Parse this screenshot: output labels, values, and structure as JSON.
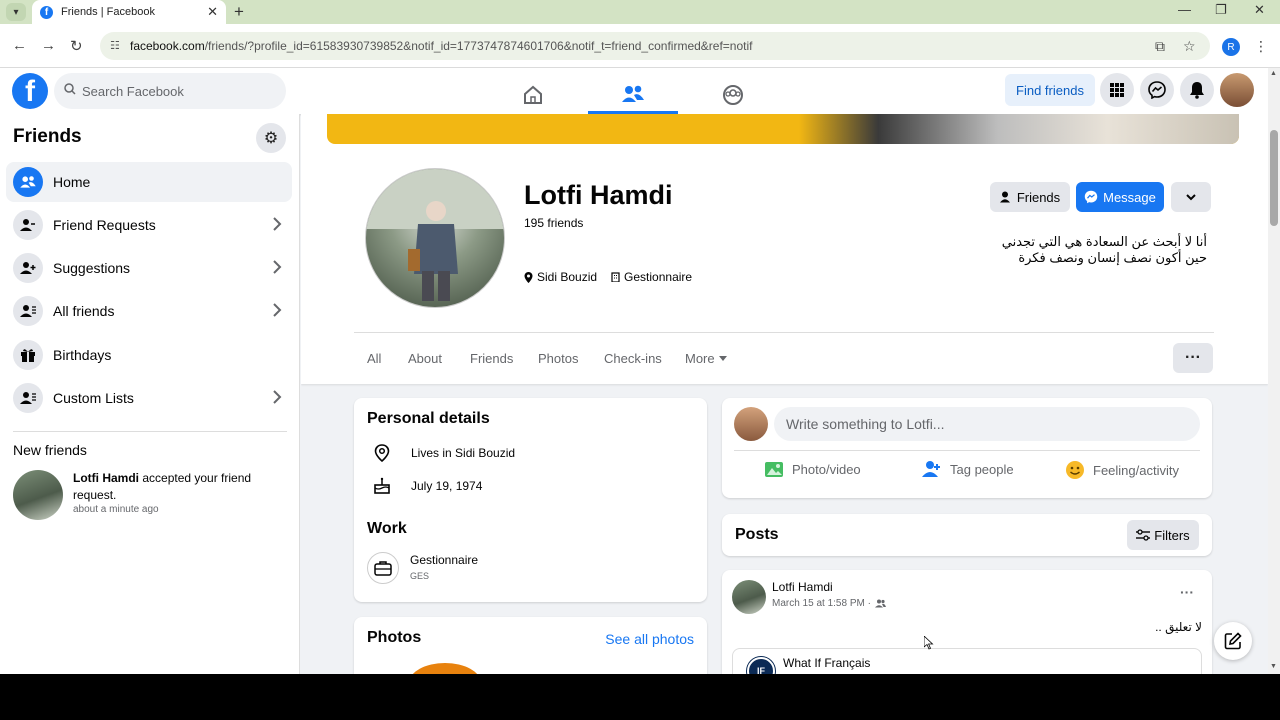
{
  "browser": {
    "tab_title": "Friends | Facebook",
    "url_domain": "facebook.com",
    "url_rest": "/friends/?profile_id=61583930739852&notif_id=1773747874601706&notif_t=friend_confirmed&ref=notif",
    "profile_initial": "R"
  },
  "fbnav": {
    "search_placeholder": "Search Facebook",
    "find_friends": "Find friends"
  },
  "sidebar": {
    "title": "Friends",
    "items": [
      {
        "label": "Home"
      },
      {
        "label": "Friend Requests"
      },
      {
        "label": "Suggestions"
      },
      {
        "label": "All friends"
      },
      {
        "label": "Birthdays"
      },
      {
        "label": "Custom Lists"
      }
    ],
    "new_friends_title": "New friends",
    "notif": {
      "name": "Lotfi Hamdi",
      "text": "accepted your friend request.",
      "time": "about a minute ago"
    }
  },
  "profile": {
    "name": "Lotfi Hamdi",
    "friends_count": "195 friends",
    "location": "Sidi Bouzid",
    "job": "Gestionnaire",
    "btn_friends": "Friends",
    "btn_message": "Message",
    "bio_line1": "أنا لا أبحث عن السعادة هي التي تجدني",
    "bio_line2": "حين أكون نصف إنسان ونصف فكرة",
    "tabs": [
      "All",
      "About",
      "Friends",
      "Photos",
      "Check-ins",
      "More"
    ]
  },
  "details": {
    "title": "Personal details",
    "lives": "Lives in Sidi Bouzid",
    "birthday": "July 19, 1974",
    "work_title": "Work",
    "work_name": "Gestionnaire",
    "work_sub": "GES"
  },
  "photos": {
    "title": "Photos",
    "see_all": "See all photos"
  },
  "composer": {
    "placeholder": "Write something to Lotfi...",
    "photo_video": "Photo/video",
    "tag_people": "Tag people",
    "feeling": "Feeling/activity"
  },
  "posts": {
    "title": "Posts",
    "filters": "Filters",
    "post": {
      "author": "Lotfi Hamdi",
      "meta": "March 15 at 1:58 PM ·",
      "text": "لا تعليق ..",
      "shared_page": "What If Français",
      "shared_initials": "IF"
    }
  }
}
